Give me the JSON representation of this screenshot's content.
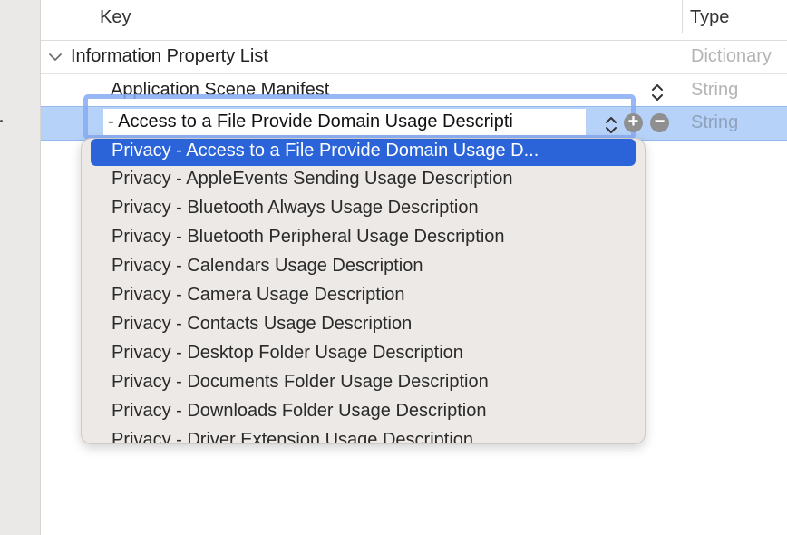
{
  "header": {
    "key_label": "Key",
    "type_label": "Type"
  },
  "root_row": {
    "key": "Information Property List",
    "type": "Dictionary"
  },
  "rows": [
    {
      "key": "Application Scene Manifest",
      "type": "String"
    }
  ],
  "selected_row": {
    "edit_value": "- Access to a File Provide Domain Usage Descripti",
    "type": "String",
    "add_symbol": "+",
    "remove_symbol": "−"
  },
  "dropdown": {
    "items": [
      "Privacy - Access to a File Provide Domain Usage D...",
      "Privacy - AppleEvents Sending Usage Description",
      "Privacy - Bluetooth Always Usage Description",
      "Privacy - Bluetooth Peripheral Usage Description",
      "Privacy - Calendars Usage Description",
      "Privacy - Camera Usage Description",
      "Privacy - Contacts Usage Description",
      "Privacy - Desktop Folder Usage Description",
      "Privacy - Documents Folder Usage Description",
      "Privacy - Downloads Folder Usage Description",
      "Privacy - Driver Extension Usage Description"
    ],
    "selected_index": 0
  },
  "colors": {
    "selection_row": "#b6d2f8",
    "menu_highlight": "#2b63d9",
    "focus_ring": "#86acf3"
  }
}
